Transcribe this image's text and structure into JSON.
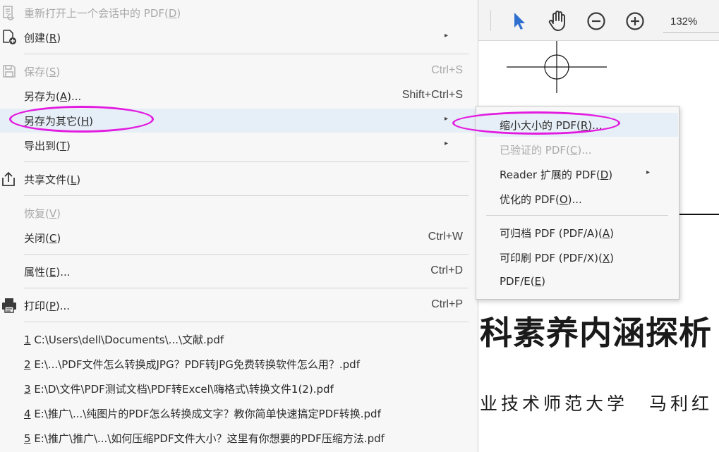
{
  "menu": {
    "items": [
      {
        "label": "重新打开上一个会话中的 PDF(",
        "key": "D",
        "tail": ")",
        "shortcut": "",
        "disabled": true,
        "icon": "reopen-icon",
        "arrow": false
      },
      {
        "label": "创建(",
        "key": "R",
        "tail": ")",
        "shortcut": "",
        "disabled": false,
        "icon": "create-pdf-icon",
        "arrow": true
      },
      {
        "label": "保存(",
        "key": "S",
        "tail": ")",
        "shortcut": "Ctrl+S",
        "disabled": true,
        "icon": "save-icon",
        "arrow": false
      },
      {
        "label": "另存为(",
        "key": "A",
        "tail": ")...",
        "shortcut": "Shift+Ctrl+S",
        "disabled": false,
        "icon": "",
        "arrow": false
      },
      {
        "label": "另存为其它(",
        "key": "H",
        "tail": ")",
        "shortcut": "",
        "disabled": false,
        "icon": "",
        "arrow": true
      },
      {
        "label": "导出到(",
        "key": "T",
        "tail": ")",
        "shortcut": "",
        "disabled": false,
        "icon": "",
        "arrow": true
      },
      {
        "label": "共享文件(",
        "key": "L",
        "tail": ")",
        "shortcut": "",
        "disabled": false,
        "icon": "share-icon",
        "arrow": false
      },
      {
        "label": "恢复(",
        "key": "V",
        "tail": ")",
        "shortcut": "",
        "disabled": true,
        "icon": "",
        "arrow": false
      },
      {
        "label": "关闭(",
        "key": "C",
        "tail": ")",
        "shortcut": "Ctrl+W",
        "disabled": false,
        "icon": "",
        "arrow": false
      },
      {
        "label": "属性(",
        "key": "E",
        "tail": ")...",
        "shortcut": "Ctrl+D",
        "disabled": false,
        "icon": "",
        "arrow": false
      },
      {
        "label": "打印(",
        "key": "P",
        "tail": ")...",
        "shortcut": "Ctrl+P",
        "disabled": false,
        "icon": "print-icon",
        "arrow": false
      }
    ],
    "recent": [
      {
        "num": "1",
        "path": " C:\\Users\\dell\\Documents\\...\\文献.pdf"
      },
      {
        "num": "2",
        "path": " E:\\...\\PDF文件怎么转换成JPG？PDF转JPG免费转换软件怎么用？.pdf"
      },
      {
        "num": "3",
        "path": " E:\\D\\文件\\PDF测试文档\\PDF转Excel\\嗨格式\\转换文件1(2).pdf"
      },
      {
        "num": "4",
        "path": " E:\\推广\\...\\纯图片的PDF怎么转换成文字？教你简单快速搞定PDF转换.pdf"
      },
      {
        "num": "5",
        "path": " E:\\推广\\推广\\...\\如何压缩PDF文件大小？这里有你想要的PDF压缩方法.pdf"
      }
    ]
  },
  "submenu": {
    "items": [
      {
        "label": "缩小大小的 PDF(",
        "key": "R",
        "tail": ")...",
        "disabled": false,
        "arrow": false
      },
      {
        "label": "已验证的 PDF(",
        "key": "C",
        "tail": ")...",
        "disabled": true,
        "arrow": false
      },
      {
        "label": "Reader 扩展的 PDF(",
        "key": "D",
        "tail": ")",
        "disabled": false,
        "arrow": true
      },
      {
        "label": "优化的 PDF(",
        "key": "O",
        "tail": ")...",
        "disabled": false,
        "arrow": false
      },
      {
        "label": "可归档 PDF (PDF/A)(",
        "key": "A",
        "tail": ")",
        "disabled": false,
        "arrow": false
      },
      {
        "label": "可印刷 PDF (PDF/X)(",
        "key": "X",
        "tail": ")",
        "disabled": false,
        "arrow": false
      },
      {
        "label": "PDF/E(",
        "key": "E",
        "tail": ")",
        "disabled": false,
        "arrow": false
      }
    ]
  },
  "toolbar": {
    "zoom": "132%",
    "tools": [
      "select-tool-icon",
      "hand-tool-icon",
      "zoom-out-icon",
      "zoom-in-icon"
    ],
    "accent": "#2f6fd0"
  },
  "document": {
    "title": "科素养内涵探析",
    "author": "业技术师范大学　马利红"
  },
  "annotation_color": "#e31be0",
  "highlight_color": "#e6eef7"
}
